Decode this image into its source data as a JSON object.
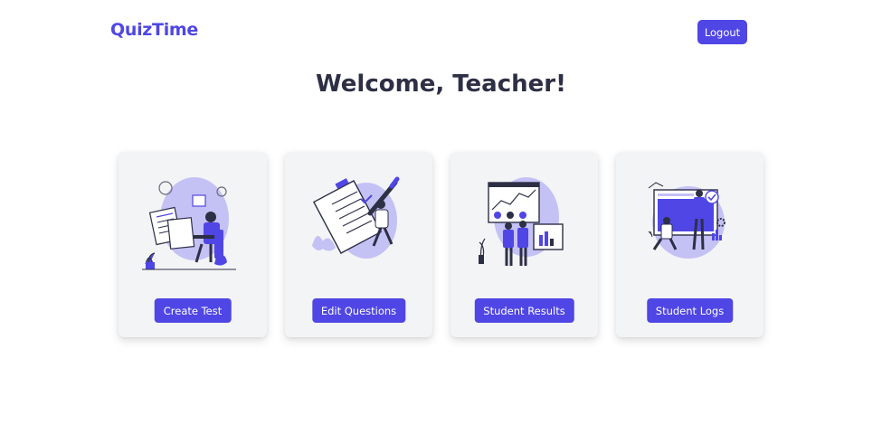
{
  "header": {
    "brand": "QuizTime",
    "logout_label": "Logout"
  },
  "main": {
    "title": "Welcome, Teacher!",
    "cards": [
      {
        "button_label": "Create Test",
        "illustration": "create-test-illustration"
      },
      {
        "button_label": "Edit Questions",
        "illustration": "edit-questions-illustration"
      },
      {
        "button_label": "Student Results",
        "illustration": "student-results-illustration"
      },
      {
        "button_label": "Student Logs",
        "illustration": "student-logs-illustration"
      }
    ]
  },
  "colors": {
    "accent": "#4f46e5",
    "accent_light": "#c4c1f5",
    "card_bg": "#f3f4f6",
    "title": "#2d2f45"
  }
}
